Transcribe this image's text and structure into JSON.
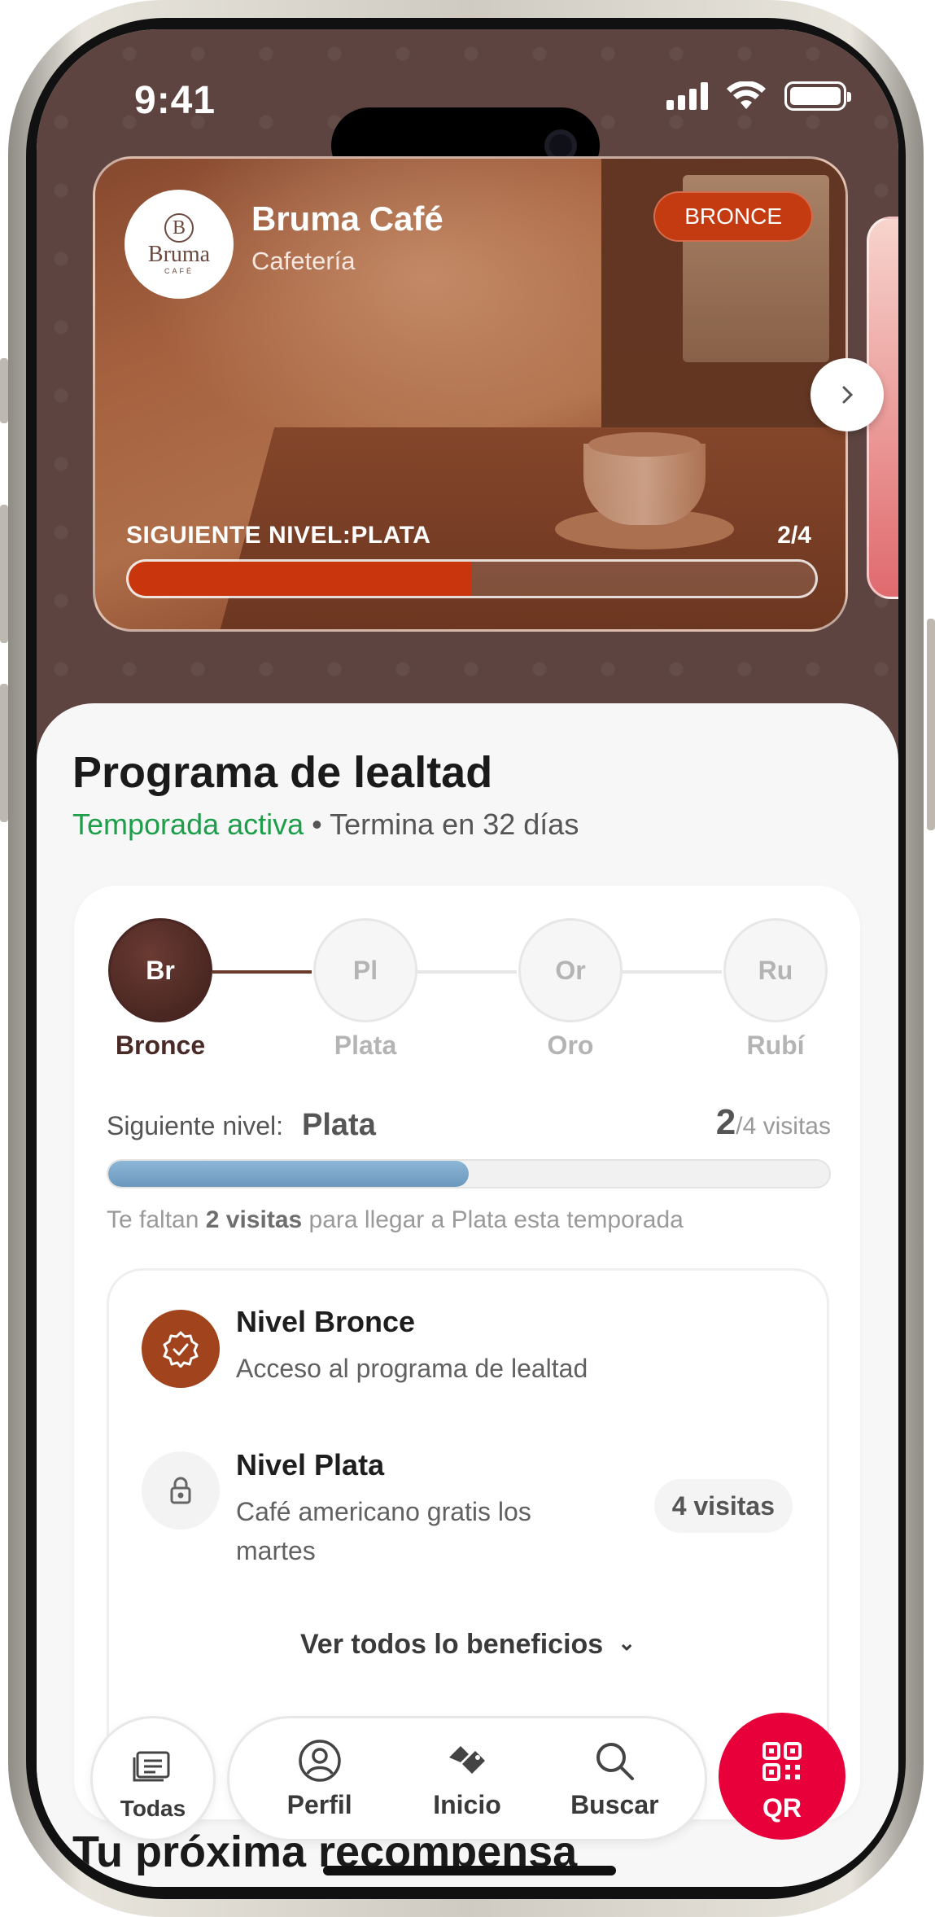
{
  "status_bar": {
    "time": "9:41"
  },
  "card": {
    "logo_letter": "B",
    "logo_word": "Bruma",
    "logo_sub": "CAFÉ",
    "name": "Bruma Café",
    "category": "Cafetería",
    "tier_badge": "BRONCE",
    "next_level": "SIGUIENTE NIVEL:PLATA",
    "progress_text": "2/4",
    "progress": 0.5,
    "accent": "#c9360e"
  },
  "loyalty": {
    "title": "Programa de lealtad",
    "season_active": "Temporada activa",
    "season_separator": "•",
    "season_ends": "Termina en 32 días",
    "tiers": [
      {
        "abbr": "Br",
        "label": "Bronce"
      },
      {
        "abbr": "Pl",
        "label": "Plata"
      },
      {
        "abbr": "Or",
        "label": "Oro"
      },
      {
        "abbr": "Ru",
        "label": "Rubí"
      }
    ],
    "current_tier_index": 0,
    "next_label": "Siguiente nivel:",
    "next_value": "Plata",
    "visits_current": "2",
    "visits_total": "/4 visitas",
    "progress": 0.5,
    "hint_prefix": "Te faltan",
    "hint_bold": "2 visitas",
    "hint_suffix": "para llegar a Plata esta temporada",
    "benefits": [
      {
        "title": "Nivel Bronce",
        "desc": "Acceso al programa de lealtad",
        "icon": "badge-check-icon",
        "state": "unlocked"
      },
      {
        "title": "Nivel Plata",
        "desc": "Café americano gratis los martes",
        "icon": "lock-icon",
        "state": "locked",
        "chip": "4 visitas"
      }
    ],
    "see_all": "Ver todos lo beneficios"
  },
  "nav": {
    "todas": "Todas",
    "perfil": "Perfil",
    "inicio": "Inicio",
    "buscar": "Buscar",
    "qr": "QR"
  },
  "next_reward_title": "Tu próxima recompensa",
  "colors": {
    "header_bg": "#5d4440",
    "active_green": "#1e9e4a",
    "qr_red": "#e8003a",
    "tier_brown": "#4a2622"
  }
}
